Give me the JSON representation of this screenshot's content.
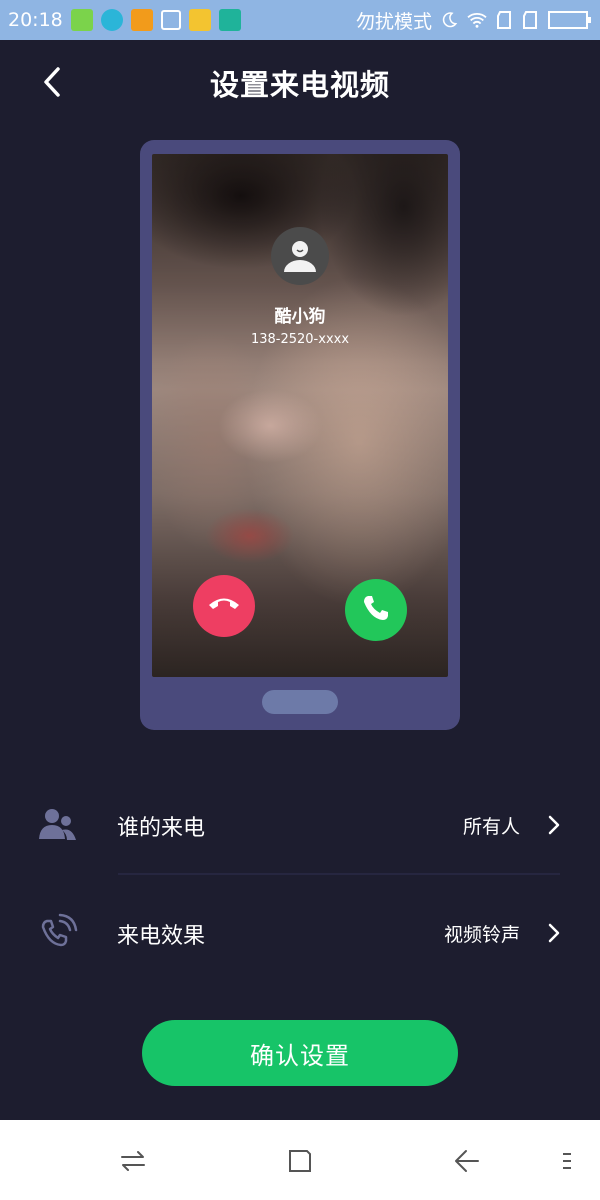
{
  "status_bar": {
    "time": "20:18",
    "dnd_label": "勿扰模式",
    "icons": [
      "android-app-icon",
      "browser-app-icon",
      "warning-icon",
      "cleanup-icon",
      "folder-icon",
      "usb-icon",
      "moon-icon",
      "wifi-icon",
      "signal-icon",
      "signal-icon",
      "battery-icon"
    ]
  },
  "header": {
    "title": "设置来电视频",
    "back_icon": "chevron-left-icon"
  },
  "preview": {
    "caller_name": "酷小狗",
    "caller_number": "138-2520-xxxx",
    "decline_icon": "phone-hangup-icon",
    "accept_icon": "phone-icon"
  },
  "settings": {
    "who_calls": {
      "label": "谁的来电",
      "value": "所有人",
      "icon": "users-icon"
    },
    "call_effect": {
      "label": "来电效果",
      "value": "视频铃声",
      "icon": "phone-ringing-icon"
    }
  },
  "confirm_button": "确认设置",
  "nav_bar": {
    "icons": [
      "switch-apps-icon",
      "home-square-icon",
      "back-arrow-icon",
      "menu-icon"
    ]
  },
  "colors": {
    "background": "#1d1d2f",
    "status_bar": "#8fb5e3",
    "phone_frame": "#4a4a7c",
    "accent_green": "#17c468",
    "decline_red": "#ee3e62",
    "icon_muted": "#6e7199"
  }
}
